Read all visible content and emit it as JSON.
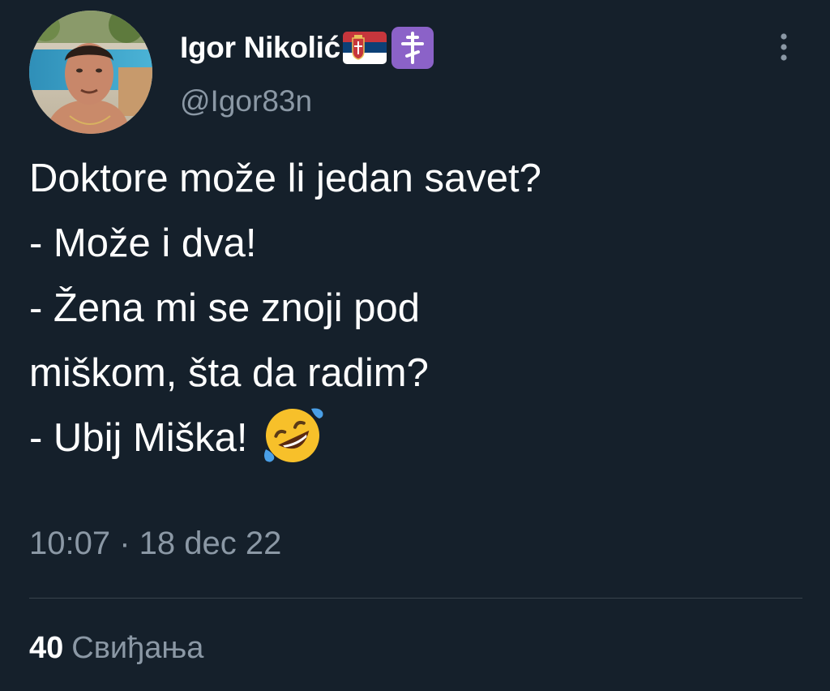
{
  "user": {
    "display_name": "Igor Nikolić",
    "handle": "@Igor83n",
    "badges": [
      "serbia-flag-icon",
      "orthodox-cross-icon"
    ]
  },
  "tweet": {
    "lines": [
      "Doktore može li jedan savet?",
      "- Može i dva!",
      "- Žena mi se znoji pod",
      "miškom, šta da radim?",
      "- Ubij Miška!"
    ],
    "emoji": "rolling-on-floor-laughing-emoji",
    "timestamp": "10:07 · 18 dec 22"
  },
  "stats": {
    "likes_count": "40",
    "likes_label": "Свиђања"
  },
  "colors": {
    "background": "#15202b",
    "text_primary": "#ffffff",
    "text_secondary": "#8b98a5",
    "divider": "#38444d",
    "badge_purple": "#8b62c8"
  }
}
